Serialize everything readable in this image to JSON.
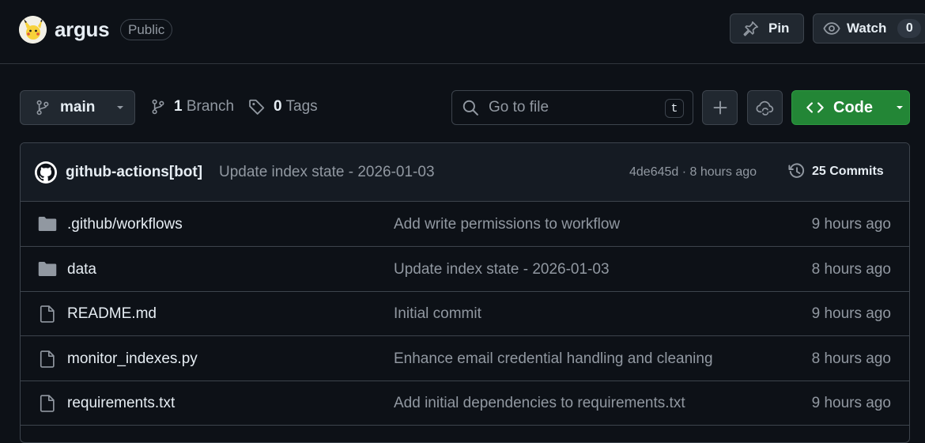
{
  "repo": {
    "name": "argus",
    "visibility": "Public",
    "pin_label": "Pin",
    "watch_label": "Watch",
    "watch_count": "0"
  },
  "toolbar": {
    "branch": "main",
    "branches_count": "1",
    "branches_label": "Branch",
    "tags_count": "0",
    "tags_label": "Tags",
    "search_placeholder": "Go to file",
    "search_shortcut": "t",
    "code_label": "Code"
  },
  "latest_commit": {
    "author": "github-actions[bot]",
    "message": "Update index state - 2026-01-03",
    "meta": "4de645d · 8 hours ago",
    "commits_label": "25 Commits"
  },
  "files": [
    {
      "name": ".github/workflows",
      "type": "folder",
      "message": "Add write permissions to workflow",
      "time": "9 hours ago"
    },
    {
      "name": "data",
      "type": "folder",
      "message": "Update index state - 2026-01-03",
      "time": "8 hours ago"
    },
    {
      "name": "README.md",
      "type": "file",
      "message": "Initial commit",
      "time": "9 hours ago"
    },
    {
      "name": "monitor_indexes.py",
      "type": "file",
      "message": "Enhance email credential handling and cleaning",
      "time": "8 hours ago"
    },
    {
      "name": "requirements.txt",
      "type": "file",
      "message": "Add initial dependencies to requirements.txt",
      "time": "9 hours ago"
    }
  ],
  "colors": {
    "background": "#0d1117",
    "accent_green": "#238636",
    "muted_text": "#9198a1",
    "border": "#3d444d"
  }
}
